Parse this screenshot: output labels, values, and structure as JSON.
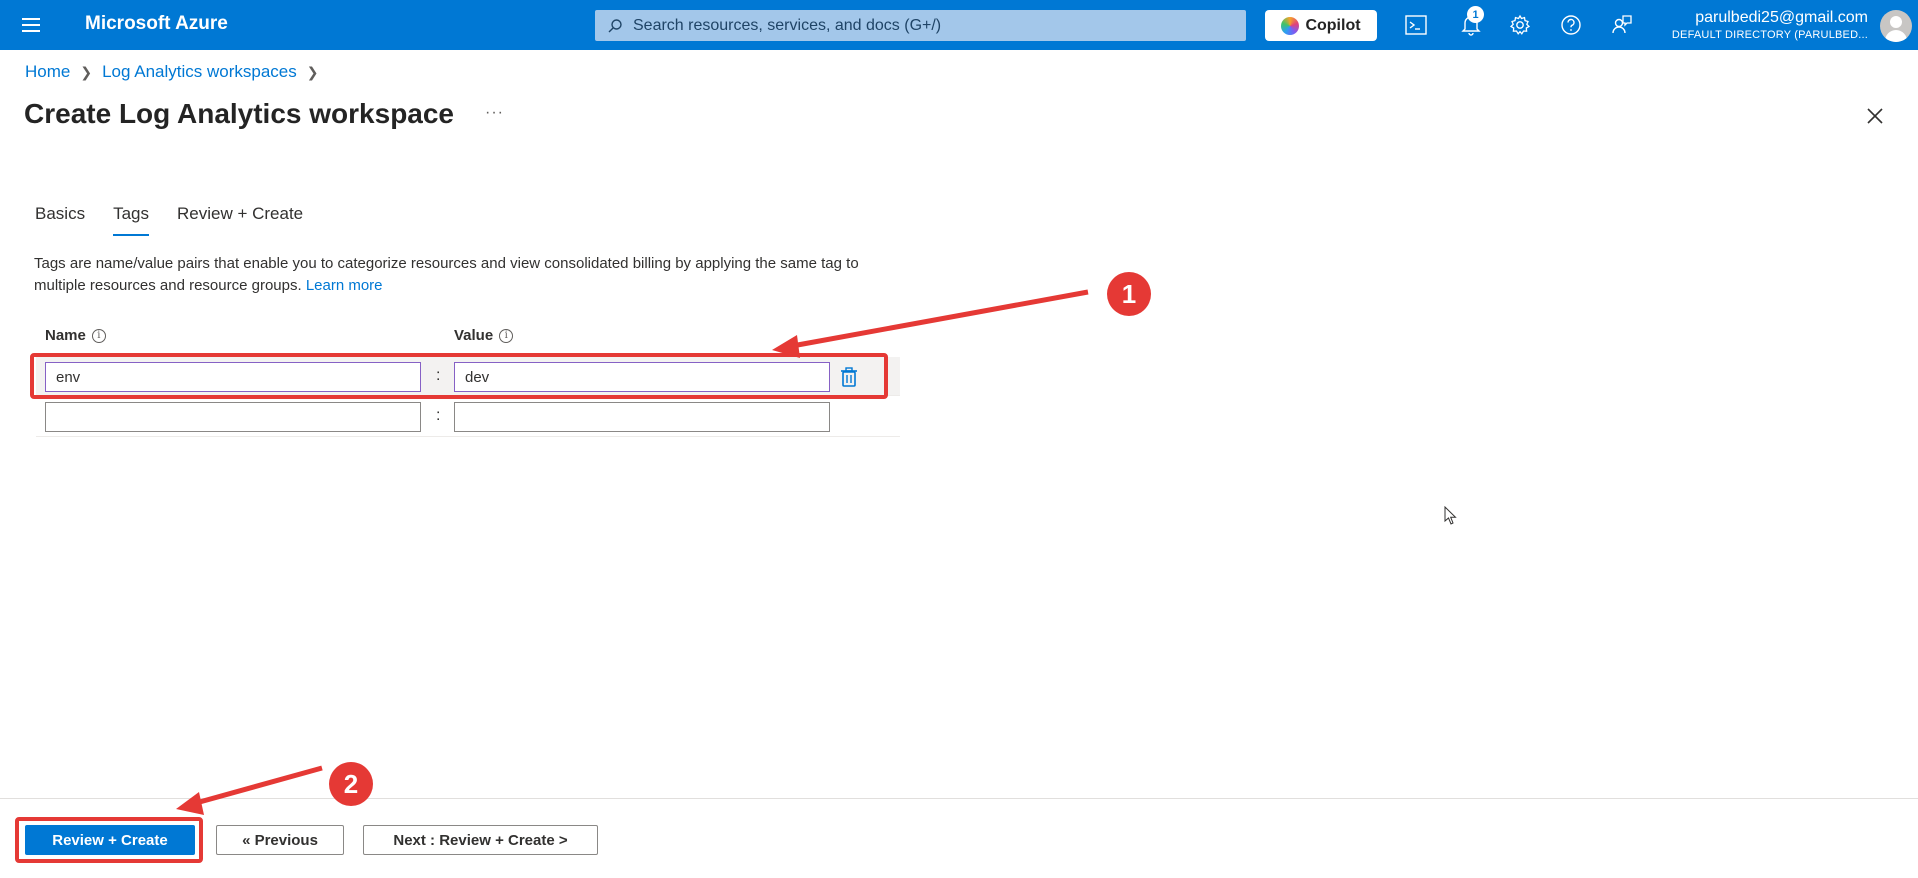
{
  "topbar": {
    "brand": "Microsoft Azure",
    "search_placeholder": "Search resources, services, and docs (G+/)",
    "copilot_label": "Copilot",
    "notification_count": "1",
    "account_email": "parulbedi25@gmail.com",
    "account_directory": "DEFAULT DIRECTORY (PARULBED...",
    "accent_color": "#0078d4"
  },
  "breadcrumb": {
    "items": [
      "Home",
      "Log Analytics workspaces"
    ]
  },
  "page": {
    "title": "Create Log Analytics workspace",
    "more_label": "···"
  },
  "tabs": [
    {
      "label": "Basics",
      "active": false
    },
    {
      "label": "Tags",
      "active": true
    },
    {
      "label": "Review + Create",
      "active": false
    }
  ],
  "tags_section": {
    "description": "Tags are name/value pairs that enable you to categorize resources and view consolidated billing by applying the same tag to multiple resources and resource groups.",
    "learn_more": "Learn more",
    "name_header": "Name",
    "value_header": "Value",
    "separator": ":",
    "rows": [
      {
        "name": "env",
        "value": "dev"
      },
      {
        "name": "",
        "value": ""
      }
    ]
  },
  "footer": {
    "review_create": "Review + Create",
    "previous": "« Previous",
    "next": "Next : Review + Create >"
  },
  "annotations": {
    "step1": "1",
    "step2": "2",
    "color": "#e53935"
  }
}
